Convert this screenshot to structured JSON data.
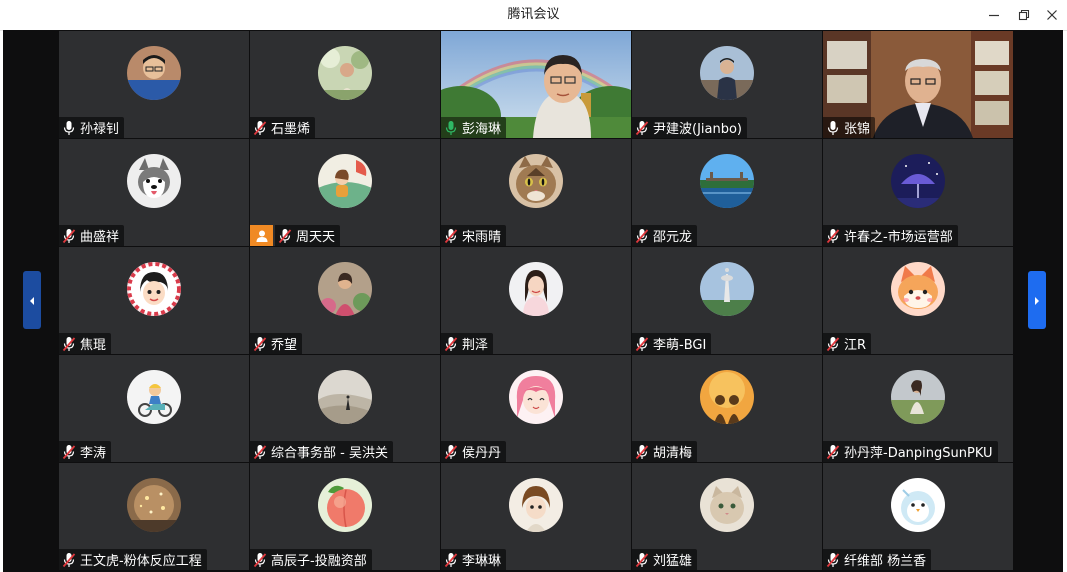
{
  "window": {
    "title": "腾讯会议"
  },
  "participants": [
    {
      "name": "孙禄钊",
      "mic": "on",
      "avatar": "photo-man-glasses"
    },
    {
      "name": "石墨烯",
      "mic": "muted",
      "avatar": "photo-girl-garden"
    },
    {
      "name": "彭海琳",
      "mic": "speaking",
      "avatar": "video-rainbow",
      "active": true
    },
    {
      "name": "尹建波(Jianbo)",
      "mic": "muted",
      "avatar": "photo-man-suit"
    },
    {
      "name": "张锦",
      "mic": "on",
      "avatar": "video-office"
    },
    {
      "name": "曲盛祥",
      "mic": "muted",
      "avatar": "husky"
    },
    {
      "name": "周天天",
      "mic": "muted",
      "avatar": "cartoon-girl",
      "host": true
    },
    {
      "name": "宋雨晴",
      "mic": "muted",
      "avatar": "cat"
    },
    {
      "name": "邵元龙",
      "mic": "muted",
      "avatar": "lake-bridge"
    },
    {
      "name": "许春之-市场运营部",
      "mic": "muted",
      "avatar": "night-umbrella"
    },
    {
      "name": "焦琨",
      "mic": "muted",
      "avatar": "cartoon-face"
    },
    {
      "name": "乔望",
      "mic": "muted",
      "avatar": "photo-girl-flowers"
    },
    {
      "name": "荆泽",
      "mic": "muted",
      "avatar": "photo-girl-smile"
    },
    {
      "name": "李萌-BGI",
      "mic": "muted",
      "avatar": "tower"
    },
    {
      "name": "江R",
      "mic": "muted",
      "avatar": "cartoon-fox"
    },
    {
      "name": "李涛",
      "mic": "muted",
      "avatar": "cartoon-scooter"
    },
    {
      "name": "综合事务部 - 吴洪关",
      "mic": "muted",
      "avatar": "dunes"
    },
    {
      "name": "侯丹丹",
      "mic": "muted",
      "avatar": "anime-pink"
    },
    {
      "name": "胡清梅",
      "mic": "muted",
      "avatar": "orange-couple"
    },
    {
      "name": "孙丹萍-DanpingSunPKU",
      "mic": "muted",
      "avatar": "photo-field"
    },
    {
      "name": "王文虎-粉体反应工程",
      "mic": "muted",
      "avatar": "sparkles"
    },
    {
      "name": "高辰子-投融资部",
      "mic": "muted",
      "avatar": "peach"
    },
    {
      "name": "李琳琳",
      "mic": "muted",
      "avatar": "doll"
    },
    {
      "name": "刘猛雄",
      "mic": "muted",
      "avatar": "kitten"
    },
    {
      "name": "纤维部 杨兰香",
      "mic": "muted",
      "avatar": "cartoon-penguin"
    }
  ],
  "colors": {
    "stage": "#0e0e0f",
    "tile": "#2e2f31",
    "speaking": "#2fb865",
    "host_badge": "#f08a24",
    "page_arrow": "#1e6cf0"
  },
  "icons": {
    "minimize": "minimize-icon",
    "restore": "restore-icon",
    "close": "close-icon",
    "mic_on": "mic-icon",
    "mic_muted": "mic-muted-icon",
    "host": "host-user-icon",
    "prev": "chevron-left-icon",
    "next": "chevron-right-icon"
  }
}
